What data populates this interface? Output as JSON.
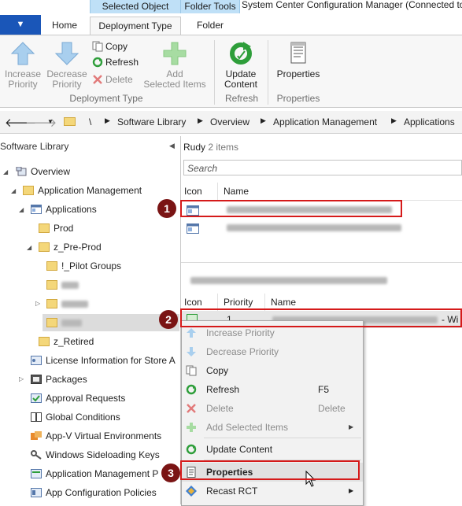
{
  "title_bar": {
    "context_tab_selected_object": "Selected Object",
    "context_tab_folder_tools": "Folder Tools",
    "window_title": "System Center Configuration Manager (Connected to"
  },
  "ribbon_tabs": {
    "home": "Home",
    "deployment_type": "Deployment Type",
    "folder": "Folder"
  },
  "ribbon": {
    "increase_priority": [
      "Increase",
      "Priority"
    ],
    "decrease_priority": [
      "Decrease",
      "Priority"
    ],
    "copy": "Copy",
    "refresh": "Refresh",
    "delete": "Delete",
    "add_selected_items": [
      "Add",
      "Selected Items"
    ],
    "update_content": [
      "Update",
      "Content"
    ],
    "properties": "Properties",
    "group_deployment_type": "Deployment Type",
    "group_refresh": "Refresh",
    "group_properties": "Properties"
  },
  "address_bar": {
    "root": "\\",
    "crumbs": [
      "Software Library",
      "Overview",
      "Application Management",
      "Applications"
    ]
  },
  "left_pane": {
    "header": "Software Library",
    "items": {
      "overview": "Overview",
      "application_management": "Application Management",
      "applications": "Applications",
      "prod": "Prod",
      "z_pre_prod": "z_Pre-Prod",
      "pilot_groups": "!_Pilot Groups",
      "z_retired": "z_Retired",
      "license_information": "License Information for Store A",
      "packages": "Packages",
      "approval_requests": "Approval Requests",
      "global_conditions": "Global Conditions",
      "appv_environments": "App-V Virtual Environments",
      "sideloading_keys": "Windows Sideloading Keys",
      "app_mgmt_policies": "Application Management P",
      "app_config_policies": "App Configuration Policies"
    }
  },
  "right_pane": {
    "folder_title": "Rudy",
    "item_count": "2 items",
    "search_placeholder": "Search",
    "col_icon": "Icon",
    "col_name": "Name",
    "dt_col_icon": "Icon",
    "dt_col_priority": "Priority",
    "dt_col_name": "Name",
    "dt_row_priority": "1",
    "dt_row_suffix": "- Wi"
  },
  "context_menu": {
    "increase_priority": "Increase Priority",
    "decrease_priority": "Decrease Priority",
    "copy": "Copy",
    "refresh": "Refresh",
    "refresh_shortcut": "F5",
    "delete": "Delete",
    "delete_shortcut": "Delete",
    "add_selected_items": "Add Selected Items",
    "update_content": "Update Content",
    "properties": "Properties",
    "recast_rct": "Recast RCT"
  },
  "callouts": {
    "one": "1",
    "two": "2",
    "three": "3"
  },
  "colors": {
    "accent": "#1a56b8",
    "callout_red": "#d51a1a",
    "badge": "#7a1414",
    "context_tab": "#bfe0f7"
  }
}
